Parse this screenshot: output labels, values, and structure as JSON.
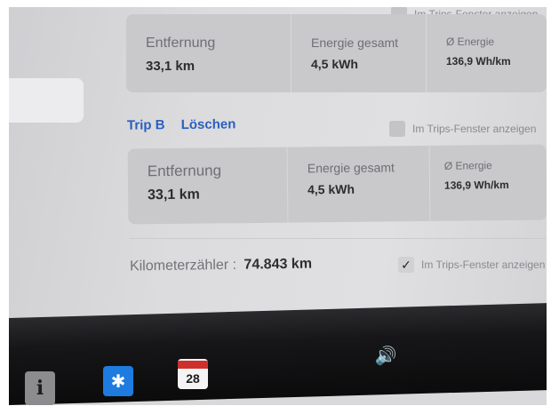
{
  "trips_option_label": "Im Trips-Fenster anzeigen",
  "trip_a": {
    "stats": [
      {
        "label": "Entfernung",
        "value": "33,1 km"
      },
      {
        "label": "Energie gesamt",
        "value": "4,5 kWh"
      },
      {
        "label": "Ø Energie",
        "value": "136,9 Wh/km"
      }
    ],
    "show_in_trips": false
  },
  "trip_b": {
    "title": "Trip B",
    "delete_label": "Löschen",
    "stats": [
      {
        "label": "Entfernung",
        "value": "33,1 km"
      },
      {
        "label": "Energie gesamt",
        "value": "4,5 kWh"
      },
      {
        "label": "Ø Energie",
        "value": "136,9 Wh/km"
      }
    ],
    "show_in_trips": false
  },
  "odometer": {
    "label": "Kilometerzähler :",
    "value": "74.843 km",
    "show_in_trips": true,
    "checkmark": "✓"
  },
  "taskbar": {
    "info_glyph": "i",
    "bluetooth_glyph": "✱",
    "calendar_day": "28",
    "volume_glyph": "🔊",
    "icons": [
      "info-icon",
      "bluetooth-icon",
      "calendar-icon",
      "volume-icon"
    ]
  },
  "colors": {
    "accent_blue": "#2a5fbf",
    "bluetooth_blue": "#1e7be0",
    "calendar_red": "#d0302c"
  }
}
